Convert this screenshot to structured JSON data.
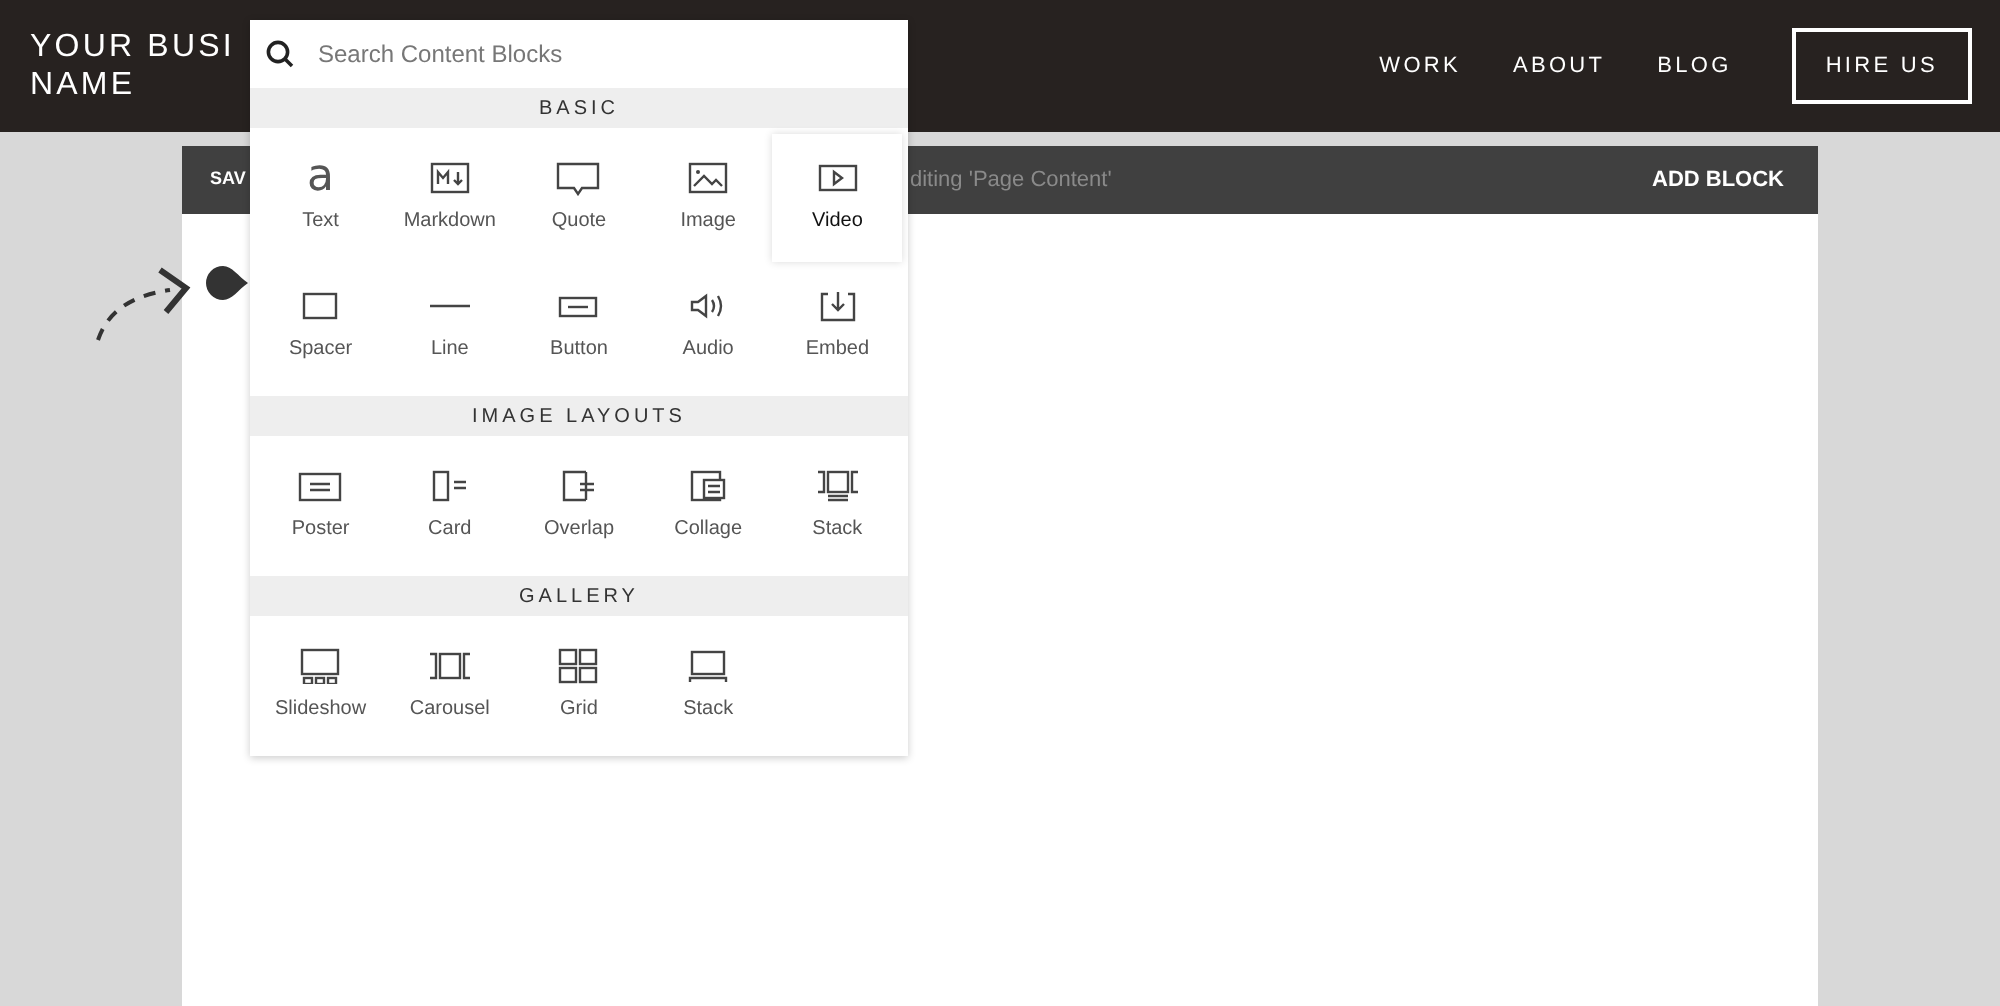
{
  "header": {
    "title_lines": [
      "YOUR BUSI",
      "NAME"
    ],
    "nav": [
      "WORK",
      "ABOUT",
      "BLOG"
    ],
    "cta": "HIRE US"
  },
  "toolbar": {
    "save": "SAV",
    "status": "diting 'Page Content'",
    "add_block": "ADD BLOCK"
  },
  "block_picker": {
    "search": {
      "placeholder": "Search Content Blocks"
    },
    "sections": [
      {
        "title": "BASIC",
        "items": [
          {
            "label": "Text",
            "selected": false,
            "icon_glyph": "a"
          },
          {
            "label": "Markdown",
            "selected": false
          },
          {
            "label": "Quote",
            "selected": false
          },
          {
            "label": "Image",
            "selected": false
          },
          {
            "label": "Video",
            "selected": true
          },
          {
            "label": "Spacer",
            "selected": false
          },
          {
            "label": "Line",
            "selected": false
          },
          {
            "label": "Button",
            "selected": false
          },
          {
            "label": "Audio",
            "selected": false
          },
          {
            "label": "Embed",
            "selected": false
          }
        ]
      },
      {
        "title": "IMAGE LAYOUTS",
        "items": [
          {
            "label": "Poster",
            "selected": false
          },
          {
            "label": "Card",
            "selected": false
          },
          {
            "label": "Overlap",
            "selected": false
          },
          {
            "label": "Collage",
            "selected": false
          },
          {
            "label": "Stack",
            "selected": false
          }
        ]
      },
      {
        "title": "GALLERY",
        "items": [
          {
            "label": "Slideshow",
            "selected": false
          },
          {
            "label": "Carousel",
            "selected": false
          },
          {
            "label": "Grid",
            "selected": false
          },
          {
            "label": "Stack",
            "selected": false
          }
        ]
      }
    ]
  }
}
